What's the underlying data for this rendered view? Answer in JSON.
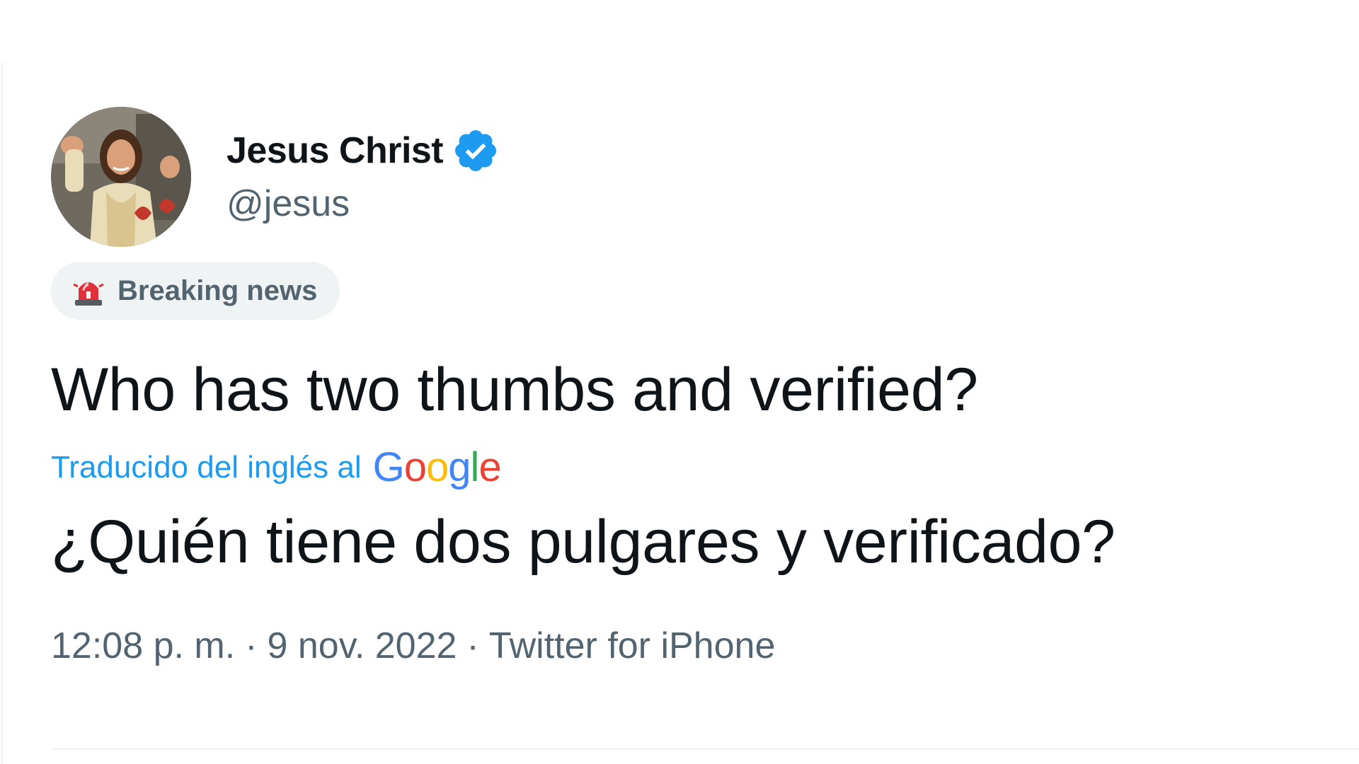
{
  "tweet": {
    "author": {
      "display_name": "Jesus Christ",
      "handle": "@jesus",
      "avatar_icon": "avatar-jesus-thumbs-up",
      "verified_icon": "verified-badge-icon"
    },
    "label": {
      "icon": "siren-icon",
      "text": "Breaking news"
    },
    "text": "Who has two thumbs and verified?",
    "translation": {
      "label": "Traducido del inglés al",
      "provider": "Google",
      "text": "¿Quién tiene dos pulgares y verificado?"
    },
    "meta": {
      "time": "12:08 p. m.",
      "separator": "·",
      "date": "9 nov. 2022",
      "source": "Twitter for iPhone"
    }
  },
  "colors": {
    "text_primary": "#0f1419",
    "text_secondary": "#536471",
    "accent": "#1d9bf0",
    "chip_background": "#eff3f4",
    "google_blue": "#4285f4",
    "google_red": "#ea4335",
    "google_yellow": "#fbbc05",
    "google_green": "#34a853"
  }
}
